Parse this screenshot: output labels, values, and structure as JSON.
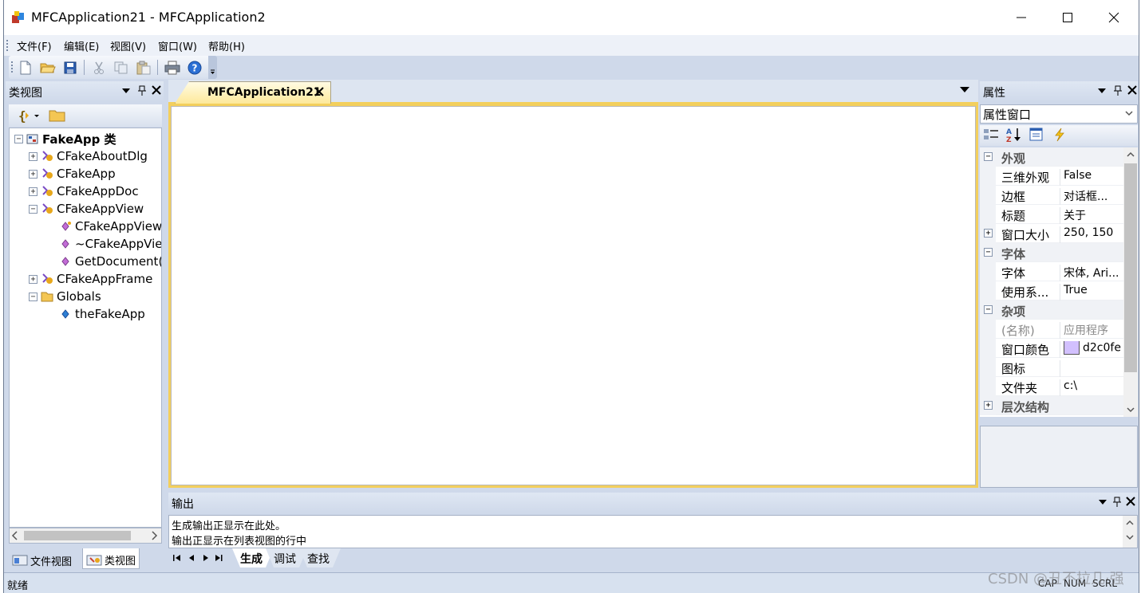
{
  "window": {
    "title": "MFCApplication21 - MFCApplication2"
  },
  "menu": {
    "items": [
      "文件(F)",
      "编辑(E)",
      "视图(V)",
      "窗口(W)",
      "帮助(H)"
    ]
  },
  "toolbar": {
    "icons": [
      "new-icon",
      "open-icon",
      "save-icon",
      "cut-icon",
      "copy-icon",
      "paste-icon",
      "print-icon",
      "help-icon"
    ]
  },
  "classview": {
    "title": "类视图",
    "tree": [
      {
        "label": "FakeApp 类",
        "level": 0,
        "expander": "−",
        "bold": true
      },
      {
        "label": "CFakeAboutDlg",
        "level": 1,
        "expander": "+"
      },
      {
        "label": "CFakeApp",
        "level": 1,
        "expander": "+"
      },
      {
        "label": "CFakeAppDoc",
        "level": 1,
        "expander": "+"
      },
      {
        "label": "CFakeAppView",
        "level": 1,
        "expander": "−"
      },
      {
        "label": "CFakeAppView",
        "level": 2,
        "expander": ""
      },
      {
        "label": "~CFakeAppView",
        "level": 2,
        "expander": ""
      },
      {
        "label": "GetDocument()",
        "level": 2,
        "expander": ""
      },
      {
        "label": "CFakeAppFrame",
        "level": 1,
        "expander": "+"
      },
      {
        "label": "Globals",
        "level": 1,
        "expander": "−"
      },
      {
        "label": "theFakeApp",
        "level": 2,
        "expander": ""
      }
    ],
    "tabs": [
      "文件视图",
      "类视图"
    ]
  },
  "document": {
    "tab_label": "MFCApplication21"
  },
  "properties": {
    "title": "属性",
    "combo": "属性窗口",
    "rows": [
      {
        "type": "cat",
        "name": "外观",
        "exp": "−"
      },
      {
        "type": "prop",
        "name": "三维外观",
        "value": "False"
      },
      {
        "type": "prop",
        "name": "边框",
        "value": "对话框..."
      },
      {
        "type": "prop",
        "name": "标题",
        "value": "关于"
      },
      {
        "type": "prop",
        "name": "窗口大小",
        "value": "250, 150",
        "exp": "+"
      },
      {
        "type": "cat",
        "name": "字体",
        "exp": "−"
      },
      {
        "type": "prop",
        "name": "字体",
        "value": "宋体, Ari..."
      },
      {
        "type": "prop",
        "name": "使用系...",
        "value": "True"
      },
      {
        "type": "cat",
        "name": "杂项",
        "exp": "−"
      },
      {
        "type": "prop",
        "name": "(名称)",
        "value": "应用程序",
        "dim": true
      },
      {
        "type": "prop",
        "name": "窗口颜色",
        "value": "d2c0fe",
        "swatch": "#d2c0fe"
      },
      {
        "type": "prop",
        "name": "图标",
        "value": ""
      },
      {
        "type": "prop",
        "name": "文件夹",
        "value": "c:\\"
      },
      {
        "type": "cat",
        "name": "层次结构",
        "exp": "+"
      }
    ]
  },
  "output": {
    "title": "输出",
    "lines": [
      "生成输出正显示在此处。",
      "输出正显示在列表视图的行中"
    ],
    "tabs": [
      "生成",
      "调试",
      "查找"
    ]
  },
  "status": {
    "text": "就绪",
    "indicators": [
      "CAP",
      "NUM",
      "SCRL"
    ]
  },
  "watermark": "CSDN @丑不拉几·强",
  "colors": {
    "doc_frame": "#f3cf5c",
    "window_bg": "#cfd9ea",
    "swatch": "#d2c0fe"
  }
}
